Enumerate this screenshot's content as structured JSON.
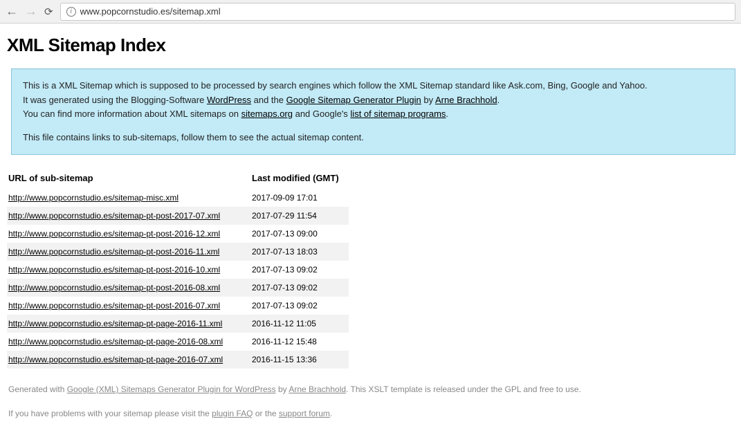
{
  "browser": {
    "url": "www.popcornstudio.es/sitemap.xml"
  },
  "page_title": "XML Sitemap Index",
  "info": {
    "line1a": "This is a XML Sitemap which is supposed to be processed by search engines which follow the XML Sitemap standard like Ask.com, Bing, Google and Yahoo.",
    "line2a": "It was generated using the Blogging-Software ",
    "link_wp": "WordPress",
    "line2b": " and the ",
    "link_gsgp": "Google Sitemap Generator Plugin",
    "line2c": " by ",
    "link_arne": "Arne Brachhold",
    "line2d": ".",
    "line3a": "You can find more information about XML sitemaps on ",
    "link_sitemaps": "sitemaps.org",
    "line3b": " and Google's ",
    "link_list": "list of sitemap programs",
    "line3c": ".",
    "line4": "This file contains links to sub-sitemaps, follow them to see the actual sitemap content."
  },
  "table": {
    "header_url": "URL of sub-sitemap",
    "header_mod": "Last modified (GMT)",
    "rows": [
      {
        "url": "http://www.popcornstudio.es/sitemap-misc.xml",
        "mod": "2017-09-09 17:01"
      },
      {
        "url": "http://www.popcornstudio.es/sitemap-pt-post-2017-07.xml",
        "mod": "2017-07-29 11:54"
      },
      {
        "url": "http://www.popcornstudio.es/sitemap-pt-post-2016-12.xml",
        "mod": "2017-07-13 09:00"
      },
      {
        "url": "http://www.popcornstudio.es/sitemap-pt-post-2016-11.xml",
        "mod": "2017-07-13 18:03"
      },
      {
        "url": "http://www.popcornstudio.es/sitemap-pt-post-2016-10.xml",
        "mod": "2017-07-13 09:02"
      },
      {
        "url": "http://www.popcornstudio.es/sitemap-pt-post-2016-08.xml",
        "mod": "2017-07-13 09:02"
      },
      {
        "url": "http://www.popcornstudio.es/sitemap-pt-post-2016-07.xml",
        "mod": "2017-07-13 09:02"
      },
      {
        "url": "http://www.popcornstudio.es/sitemap-pt-page-2016-11.xml",
        "mod": "2016-11-12 11:05"
      },
      {
        "url": "http://www.popcornstudio.es/sitemap-pt-page-2016-08.xml",
        "mod": "2016-11-12 15:48"
      },
      {
        "url": "http://www.popcornstudio.es/sitemap-pt-page-2016-07.xml",
        "mod": "2016-11-15 13:36"
      }
    ]
  },
  "footer": {
    "gen_a": "Generated with ",
    "gen_link": "Google (XML) Sitemaps Generator Plugin for WordPress",
    "gen_b": " by ",
    "gen_arne": "Arne Brachhold",
    "gen_c": ". This XSLT template is released under the GPL and free to use.",
    "prob_a": "If you have problems with your sitemap please visit the ",
    "prob_faq": "plugin FAQ",
    "prob_b": " or the ",
    "prob_forum": "support forum",
    "prob_c": "."
  }
}
